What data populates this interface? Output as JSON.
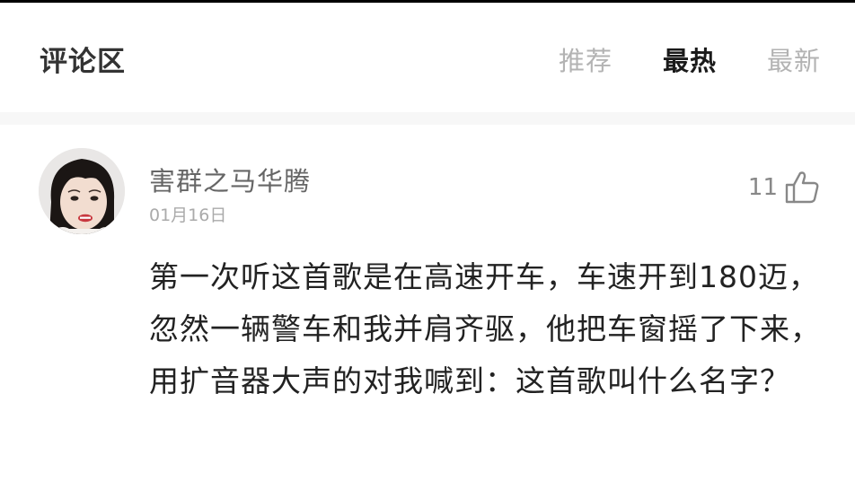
{
  "header": {
    "title": "评论区",
    "tabs": [
      {
        "label": "推荐",
        "active": false
      },
      {
        "label": "最热",
        "active": true
      },
      {
        "label": "最新",
        "active": false
      }
    ]
  },
  "comment": {
    "username": "害群之马华腾",
    "date": "01月16日",
    "likes": "11",
    "like_icon": "thumbs-up-icon",
    "text": "第一次听这首歌是在高速开车，车速开到180迈，忽然一辆警车和我并肩齐驱，他把车窗摇了下来，用扩音器大声的对我喊到：这首歌叫什么名字？"
  },
  "colors": {
    "title": "#333333",
    "tab_active": "#1a1a1a",
    "tab_inactive": "#b3b3b3",
    "username": "#666666",
    "date": "#aaaaaa",
    "text": "#222222",
    "divider": "#f7f7f7"
  }
}
